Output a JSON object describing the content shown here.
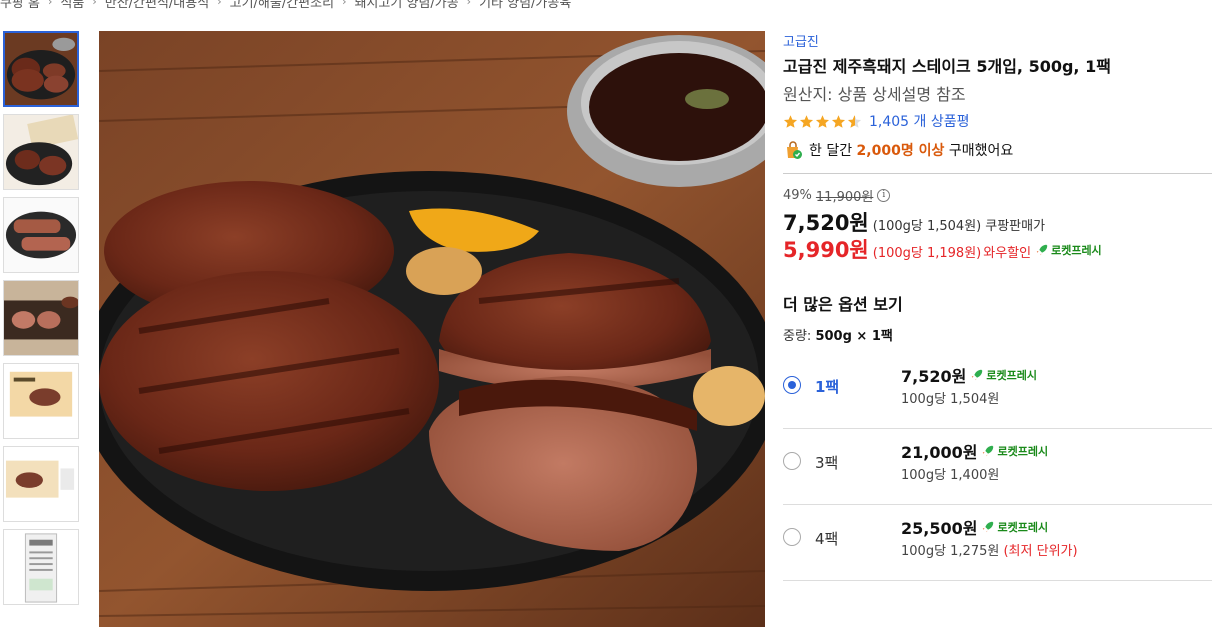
{
  "breadcrumb": [
    "쿠팡 홈",
    "식품",
    "반찬/간편식/대용식",
    "고기/해물/간편조리",
    "돼지고기 양념/가공",
    "기타 양념/가공육"
  ],
  "brand": "고급진",
  "title": "고급진 제주흑돼지 스테이크 5개입, 500g, 1팩",
  "origin": "원산지: 상품 상세설명 참조",
  "rating": {
    "stars": 4.5,
    "count_label": "1,405 개 상품평"
  },
  "monthly": {
    "prefix": "한 달간",
    "highlight": "2,000명 이상",
    "suffix": "구매했어요"
  },
  "price": {
    "discount_pct": "49%",
    "original": "11,900원",
    "info_icon": "i",
    "sale": "7,520원",
    "sale_unit": "(100g당 1,504원)",
    "sale_label": "쿠팡판매가",
    "wow": "5,990원",
    "wow_unit": "(100g당 1,198원)",
    "wow_label": "와우할인",
    "rocket": "로켓프레시"
  },
  "more_options_title": "더 많은 옵션 보기",
  "weight": {
    "label": "중량:",
    "value": "500g × 1팩"
  },
  "options": [
    {
      "label": "1팩",
      "price": "7,520원",
      "rocket": "로켓프레시",
      "unit": "100g당 1,504원",
      "note": "",
      "selected": true
    },
    {
      "label": "3팩",
      "price": "21,000원",
      "rocket": "로켓프레시",
      "unit": "100g당 1,400원",
      "note": "",
      "selected": false
    },
    {
      "label": "4팩",
      "price": "25,500원",
      "rocket": "로켓프레시",
      "unit": "100g당 1,275원",
      "note": "(최저 단위가)",
      "selected": false
    }
  ],
  "colors": {
    "link": "#2b62d9",
    "wow": "#e52528",
    "highlight": "#d9590b",
    "rocket": "#1a8a1a"
  },
  "icons": {
    "thumbs": [
      "steak-thumbnail-icon",
      "package-thumbnail-icon",
      "sliced-steak-icon",
      "cooking-steak-icon",
      "package-front-icon",
      "package-side-icon",
      "package-back-icon"
    ]
  }
}
